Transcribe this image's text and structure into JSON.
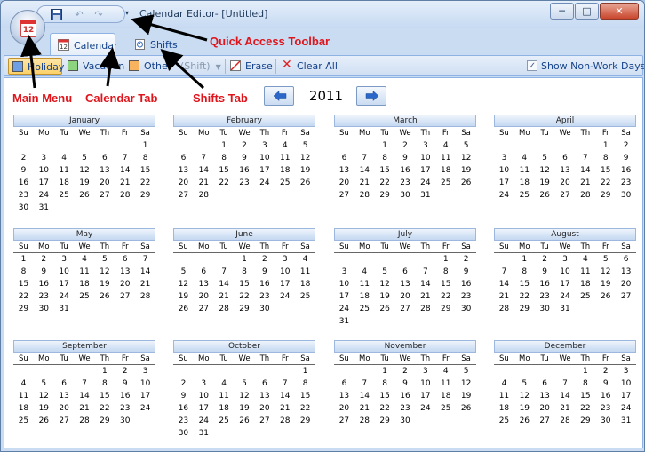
{
  "window": {
    "title": "Calendar Editor- [Untitled]",
    "app_icon_day": "12",
    "controls": {
      "minimize": "─",
      "maximize": "□",
      "close": "✕"
    }
  },
  "quick_access_toolbar": {
    "icons": [
      "save-icon",
      "undo-icon",
      "redo-icon"
    ],
    "overflow": "▾"
  },
  "tabs": [
    {
      "label": "Calendar",
      "active": true
    },
    {
      "label": "Shifts",
      "active": false
    }
  ],
  "ribbon": {
    "holiday": {
      "label": "Holiday",
      "color": "#6fa0e6"
    },
    "vacation": {
      "label": "Vacation",
      "color": "#8cd47e"
    },
    "other": {
      "label": "Other",
      "color": "#f7b35d"
    },
    "shift": {
      "label": "(Shift)"
    },
    "erase": {
      "label": "Erase"
    },
    "clear_all": {
      "label": "Clear All"
    },
    "show_non_work_days": {
      "label": "Show Non-Work Days",
      "checked": true
    }
  },
  "year": "2011",
  "days_of_week": [
    "Su",
    "Mo",
    "Tu",
    "We",
    "Th",
    "Fr",
    "Sa"
  ],
  "months": [
    {
      "name": "January",
      "start": 6,
      "days": 31
    },
    {
      "name": "February",
      "start": 2,
      "days": 28
    },
    {
      "name": "March",
      "start": 2,
      "days": 31
    },
    {
      "name": "April",
      "start": 5,
      "days": 30
    },
    {
      "name": "May",
      "start": 0,
      "days": 31
    },
    {
      "name": "June",
      "start": 3,
      "days": 30
    },
    {
      "name": "July",
      "start": 5,
      "days": 31
    },
    {
      "name": "August",
      "start": 1,
      "days": 31
    },
    {
      "name": "September",
      "start": 4,
      "days": 30
    },
    {
      "name": "October",
      "start": 6,
      "days": 31
    },
    {
      "name": "November",
      "start": 2,
      "days": 30
    },
    {
      "name": "December",
      "start": 4,
      "days": 31
    }
  ],
  "annotations": {
    "quick_access_toolbar": "Quick Access Toolbar",
    "main_menu": "Main Menu",
    "calendar_tab": "Calendar Tab",
    "shifts_tab": "Shifts Tab"
  }
}
